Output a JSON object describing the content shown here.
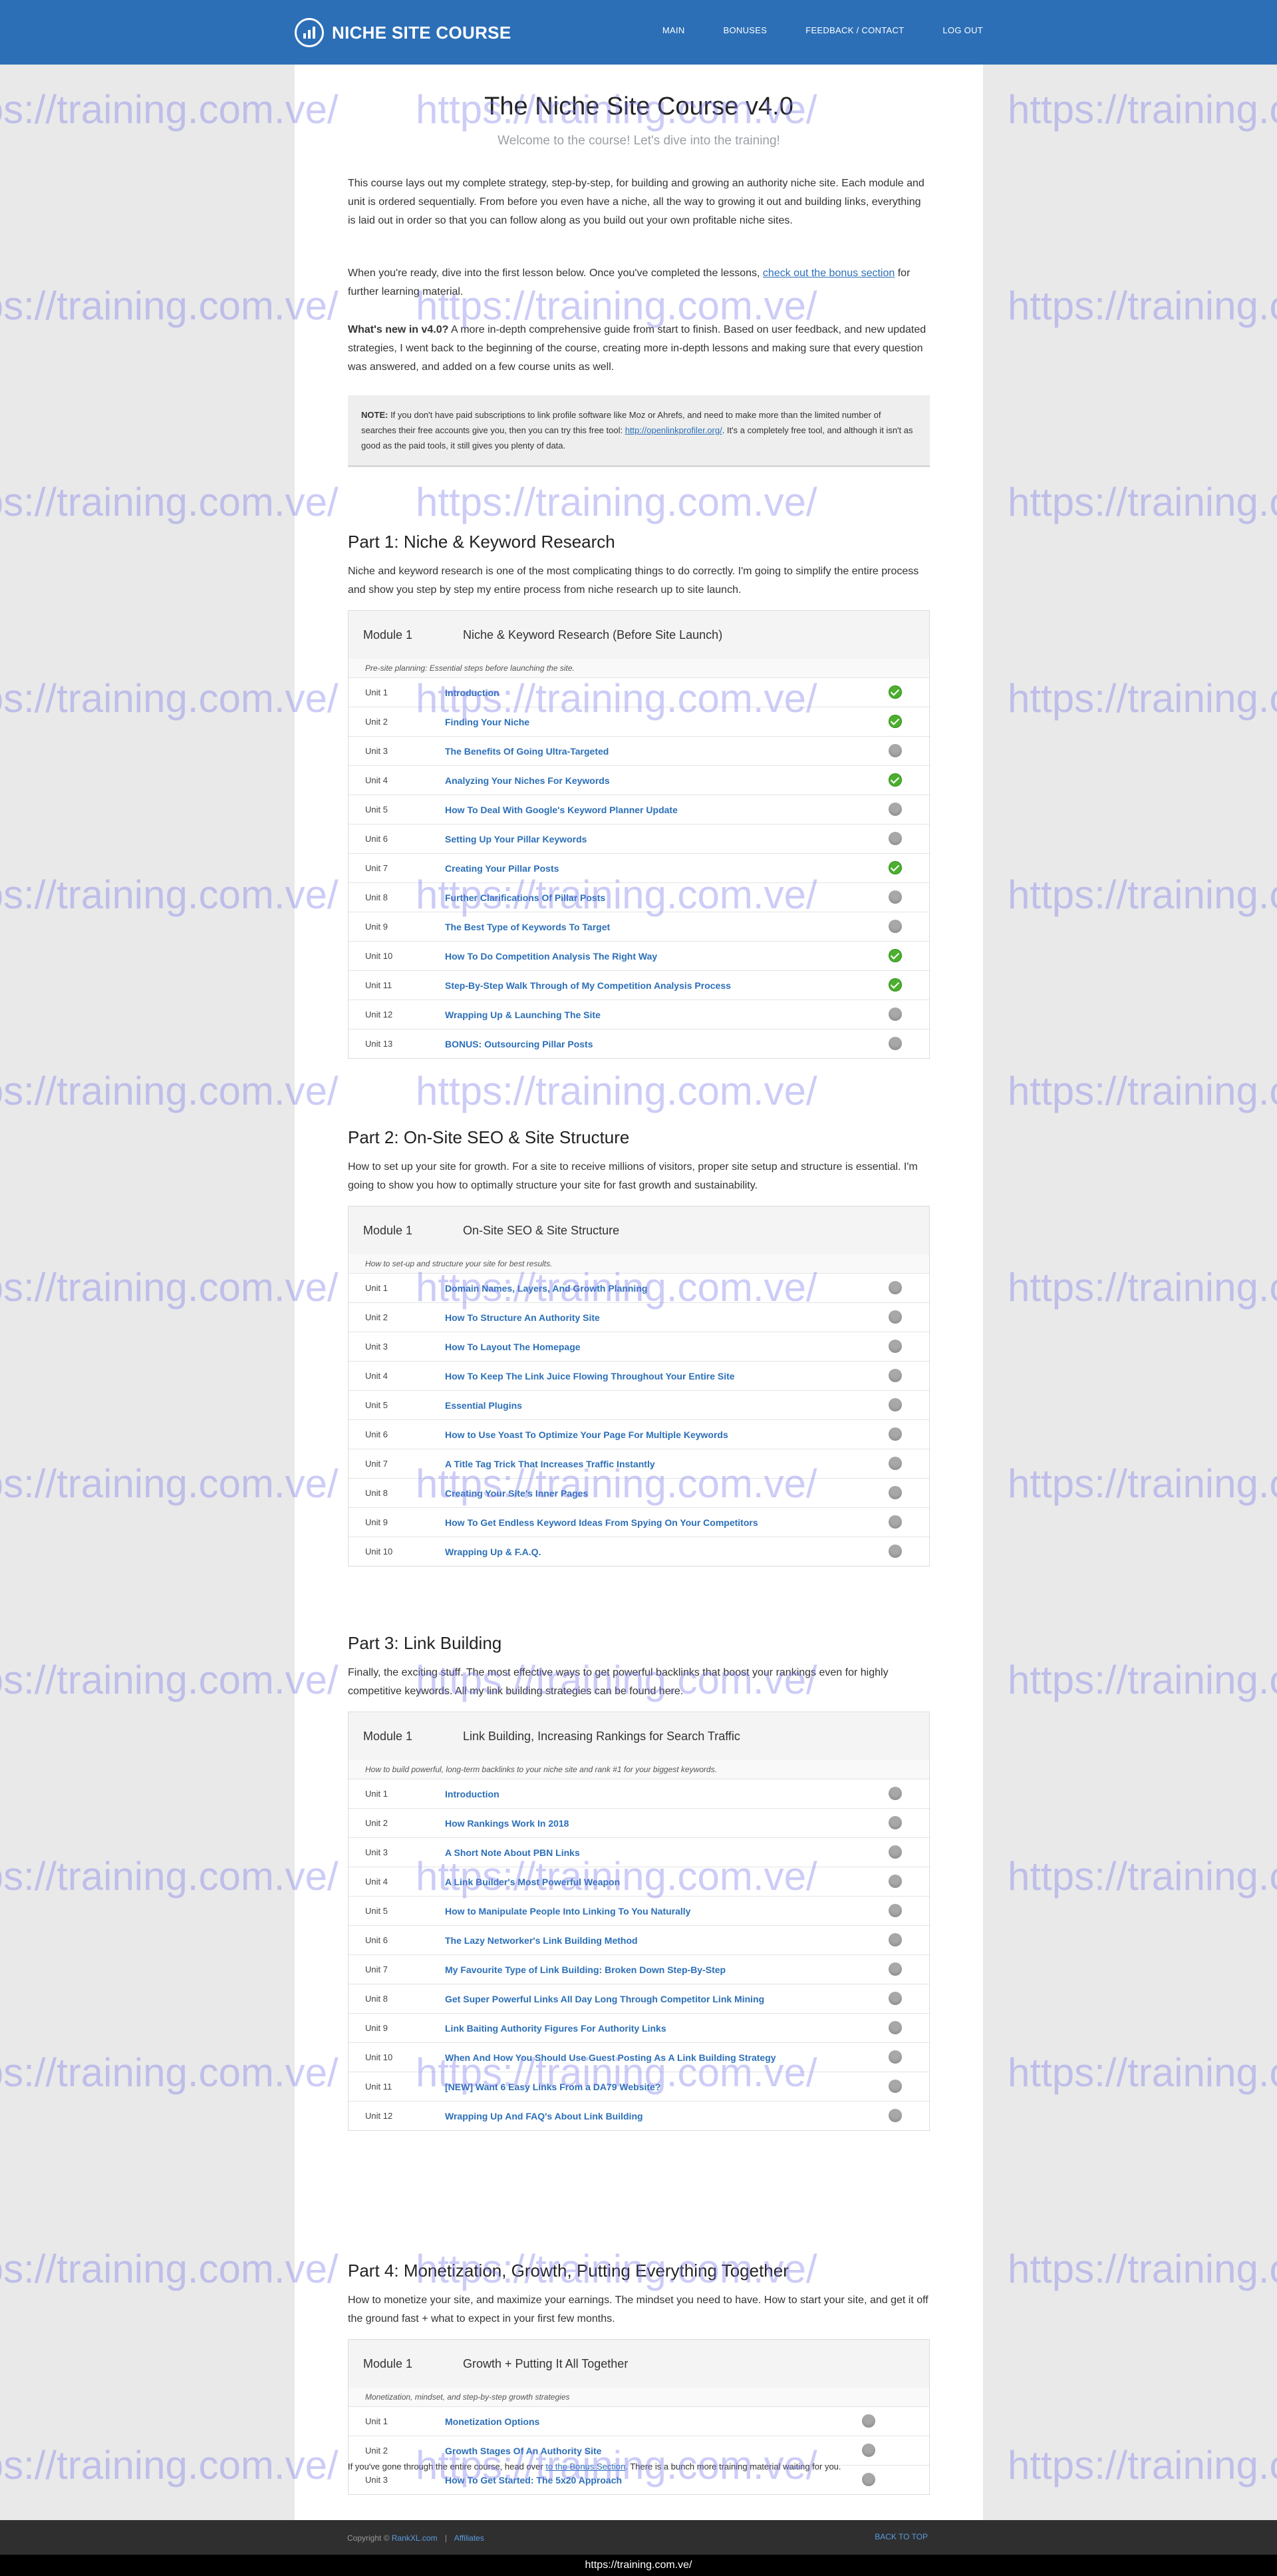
{
  "header": {
    "logo_text": "NICHE SITE COURSE",
    "nav": [
      "MAIN",
      "BONUSES",
      "FEEDBACK / CONTACT",
      "LOG OUT"
    ]
  },
  "page": {
    "title": "The Niche Site Course v4.0",
    "subtitle": "Welcome to the course! Let's dive into the training!",
    "intro1": "This course lays out my complete strategy, step-by-step, for building and growing an authority niche site. Each module and unit is ordered sequentially. From before you even have a niche, all the way to growing it out and building links, everything is laid out in order so that you can follow along as you build out your own profitable niche sites.",
    "intro2_before": "When you're ready, dive into the first lesson below. Once you've completed the lessons, ",
    "intro2_link": "check out the bonus section",
    "intro2_after": " for further learning material.",
    "new_bold": "What's new in v4.0?",
    "new_text": " A more in-depth comprehensive guide from start to finish. Based on user feedback, and new updated strategies, I went back to the beginning of the course, creating more in-depth lessons and making sure that every question was answered, and added on a few course units as well.",
    "note_bold": "NOTE:",
    "note_before": " If you don't have paid subscriptions to link profile software like Moz or Ahrefs, and need to make more than the limited number of searches their free accounts give you, then you can try this free tool: ",
    "note_link": "http://openlinkprofiler.org/",
    "note_after": ". It's a completely free tool, and although it isn't as good as the paid tools, it still gives you plenty of data."
  },
  "parts": [
    {
      "title": "Part 1: Niche & Keyword Research",
      "desc": "Niche and keyword research is one of the most complicating things to do correctly. I'm going to simplify the entire process and show you step by step my entire process from niche research up to site launch.",
      "module_num": "Module 1",
      "module_name": "Niche & Keyword Research (Before Site Launch)",
      "module_desc": "Pre-site planning: Essential steps before launching the site.",
      "units": [
        {
          "unit": "Unit 1",
          "title": "Introduction",
          "done": true
        },
        {
          "unit": "Unit 2",
          "title": "Finding Your Niche",
          "done": true
        },
        {
          "unit": "Unit 3",
          "title": "The Benefits Of Going Ultra-Targeted",
          "done": false
        },
        {
          "unit": "Unit 4",
          "title": "Analyzing Your Niches For Keywords",
          "done": true
        },
        {
          "unit": "Unit 5",
          "title": "How To Deal With Google's Keyword Planner Update",
          "done": false
        },
        {
          "unit": "Unit 6",
          "title": "Setting Up Your Pillar Keywords",
          "done": false
        },
        {
          "unit": "Unit 7",
          "title": "Creating Your Pillar Posts",
          "done": true
        },
        {
          "unit": "Unit 8",
          "title": "Further Clarifications Of Pillar Posts",
          "done": false
        },
        {
          "unit": "Unit 9",
          "title": "The Best Type of Keywords To Target",
          "done": false
        },
        {
          "unit": "Unit 10",
          "title": "How To Do Competition Analysis The Right Way",
          "done": true
        },
        {
          "unit": "Unit 11",
          "title": "Step-By-Step Walk Through of My Competition Analysis Process",
          "done": true
        },
        {
          "unit": "Unit 12",
          "title": "Wrapping Up & Launching The Site",
          "done": false
        },
        {
          "unit": "Unit 13",
          "title": "BONUS: Outsourcing Pillar Posts",
          "done": false
        }
      ]
    },
    {
      "title": "Part 2: On-Site SEO & Site Structure",
      "desc": "How to set up your site for growth. For a site to receive millions of visitors, proper site setup and structure is essential. I'm going to show you how to optimally structure your site for fast growth and sustainability.",
      "module_num": "Module 1",
      "module_name": "On-Site SEO & Site Structure",
      "module_desc": "How to set-up and structure your site for best results.",
      "units": [
        {
          "unit": "Unit 1",
          "title": "Domain Names, Layers, And Growth Planning",
          "done": false
        },
        {
          "unit": "Unit 2",
          "title": "How To Structure An Authority Site",
          "done": false
        },
        {
          "unit": "Unit 3",
          "title": "How To Layout The Homepage",
          "done": false
        },
        {
          "unit": "Unit 4",
          "title": "How To Keep The Link Juice Flowing Throughout Your Entire Site",
          "done": false
        },
        {
          "unit": "Unit 5",
          "title": "Essential Plugins",
          "done": false
        },
        {
          "unit": "Unit 6",
          "title": "How to Use Yoast To Optimize Your Page For Multiple Keywords",
          "done": false
        },
        {
          "unit": "Unit 7",
          "title": "A Title Tag Trick That Increases Traffic Instantly",
          "done": false
        },
        {
          "unit": "Unit 8",
          "title": "Creating Your Site's Inner Pages",
          "done": false
        },
        {
          "unit": "Unit 9",
          "title": "How To Get Endless Keyword Ideas From Spying On Your Competitors",
          "done": false
        },
        {
          "unit": "Unit 10",
          "title": "Wrapping Up & F.A.Q.",
          "done": false
        }
      ]
    },
    {
      "title": "Part 3: Link Building",
      "desc": "Finally, the exciting stuff. The most effective ways to get powerful backlinks that boost your rankings even for highly competitive keywords. All my link building strategies can be found here.",
      "module_num": "Module 1",
      "module_name": "Link Building, Increasing Rankings for Search Traffic",
      "module_desc": "How to build powerful, long-term backlinks to your niche site and rank #1 for your biggest keywords.",
      "units": [
        {
          "unit": "Unit 1",
          "title": "Introduction",
          "done": false
        },
        {
          "unit": "Unit 2",
          "title": "How Rankings Work In 2018",
          "done": false
        },
        {
          "unit": "Unit 3",
          "title": "A Short Note About PBN Links",
          "done": false
        },
        {
          "unit": "Unit 4",
          "title": "A Link Builder's Most Powerful Weapon",
          "done": false
        },
        {
          "unit": "Unit 5",
          "title": "How to Manipulate People Into Linking To You Naturally",
          "done": false
        },
        {
          "unit": "Unit 6",
          "title": "The Lazy Networker's Link Building Method",
          "done": false
        },
        {
          "unit": "Unit 7",
          "title": "My Favourite Type of Link Building: Broken Down Step-By-Step",
          "done": false
        },
        {
          "unit": "Unit 8",
          "title": "Get Super Powerful Links All Day Long Through Competitor Link Mining",
          "done": false
        },
        {
          "unit": "Unit 9",
          "title": "Link Baiting Authority Figures For Authority Links",
          "done": false
        },
        {
          "unit": "Unit 10",
          "title": "When And How You Should Use Guest Posting As A Link Building Strategy",
          "done": false
        },
        {
          "unit": "Unit 11",
          "title": "[NEW] Want 6 Easy Links From a DA79 Website?",
          "done": false
        },
        {
          "unit": "Unit 12",
          "title": "Wrapping Up And FAQ's About Link Building",
          "done": false
        }
      ]
    },
    {
      "title": "Part 4: Monetization, Growth, Putting Everything Together",
      "desc": "How to monetize your site, and maximize your earnings. The mindset you need to have. How to start your site, and get it off the ground fast + what to expect in your first few months.",
      "module_num": "Module 1",
      "module_name": "Growth + Putting It All Together",
      "module_desc": "Monetization, mindset, and step-by-step growth strategies",
      "units": [
        {
          "unit": "Unit 1",
          "title": "Monetization Options",
          "done": false
        },
        {
          "unit": "Unit 2",
          "title": "Growth Stages Of An Authority Site",
          "done": false
        },
        {
          "unit": "Unit 3",
          "title": "How To Get Started: The 5x20 Approach",
          "done": false
        }
      ]
    }
  ],
  "closing": {
    "before": "If you've gone through the entire course, head over ",
    "link": "to the Bonus Section",
    "after": ". There is a bunch more training material waiting for you."
  },
  "footer": {
    "copyright_prefix": "Copyright © ",
    "copyright_link": "RankXL.com",
    "separator": "|",
    "affiliates": "Affiliates",
    "back_to_top": "BACK TO TOP"
  },
  "watermark": "https://training.com.ve/",
  "url_bar": "https://training.com.ve/",
  "colors": {
    "brand": "#2c6fb7",
    "done": "#4caf2e",
    "todo": "#a8a8a8"
  }
}
